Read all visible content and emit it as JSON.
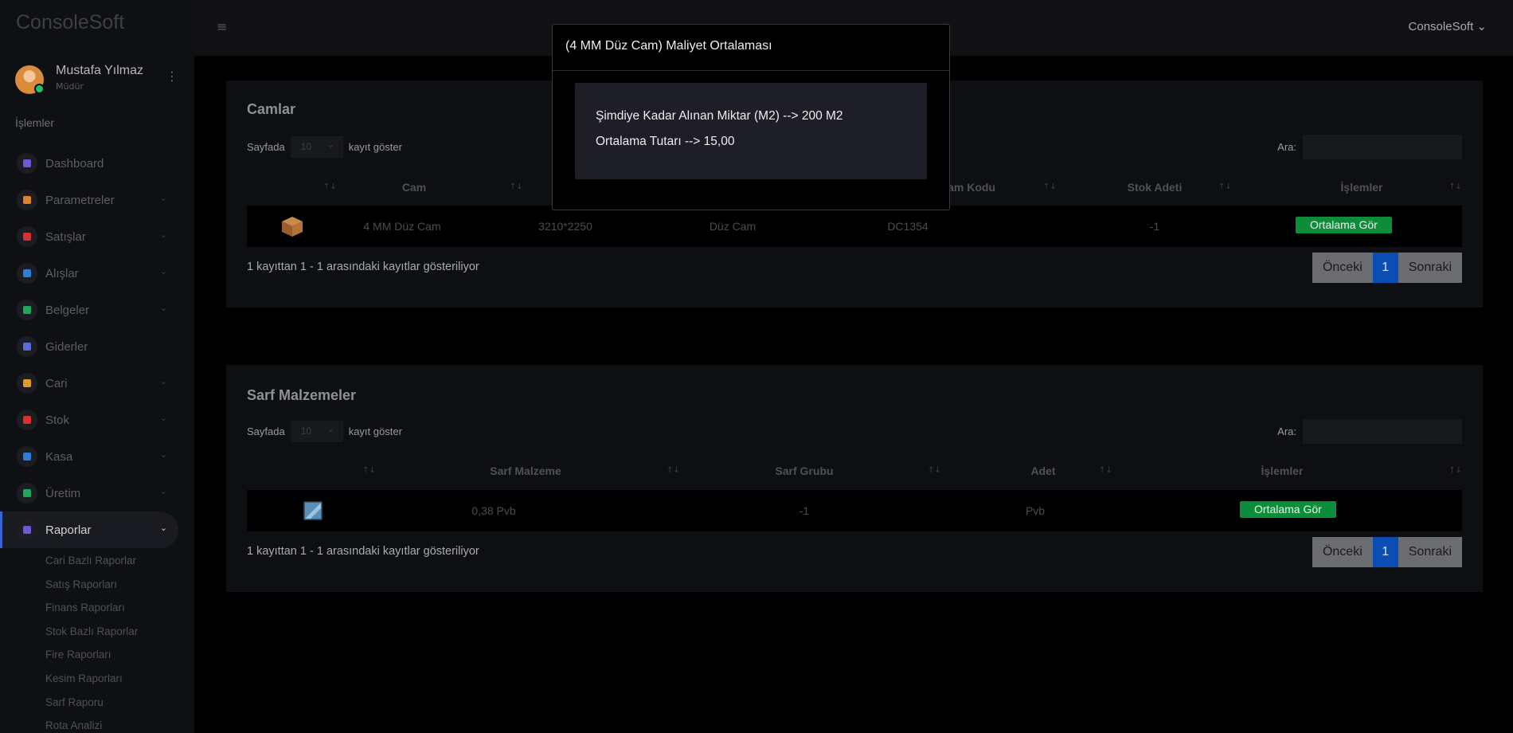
{
  "app": {
    "brand": "ConsoleSoft",
    "top_user": "ConsoleSoft"
  },
  "user": {
    "name": "Mustafa Yılmaz",
    "role": "Müdür"
  },
  "sidebar": {
    "section": "İşlemler",
    "items": [
      {
        "label": "Dashboard",
        "icon": "dashboard-icon",
        "color": "#6f58d6",
        "has_children": false
      },
      {
        "label": "Parametreler",
        "icon": "layers-icon",
        "color": "#e0822b",
        "has_children": true
      },
      {
        "label": "Satışlar",
        "icon": "sales-icon",
        "color": "#d93030",
        "has_children": true
      },
      {
        "label": "Alışlar",
        "icon": "purchase-icon",
        "color": "#2b7fd9",
        "has_children": true
      },
      {
        "label": "Belgeler",
        "icon": "documents-icon",
        "color": "#1fa85a",
        "has_children": true
      },
      {
        "label": "Giderler",
        "icon": "expense-icon",
        "color": "#5a6bd8",
        "has_children": false
      },
      {
        "label": "Cari",
        "icon": "users-icon",
        "color": "#e09b2b",
        "has_children": true
      },
      {
        "label": "Stok",
        "icon": "stock-icon",
        "color": "#d93030",
        "has_children": true
      },
      {
        "label": "Kasa",
        "icon": "cash-icon",
        "color": "#2b7fd9",
        "has_children": true
      },
      {
        "label": "Üretim",
        "icon": "production-icon",
        "color": "#1fa85a",
        "has_children": true
      },
      {
        "label": "Raporlar",
        "icon": "reports-icon",
        "color": "#6f58d6",
        "has_children": true,
        "active": true
      }
    ],
    "sub_items": [
      "Cari Bazlı Raporlar",
      "Satış Raporları",
      "Finans Raporları",
      "Stok Bazlı Raporlar",
      "Fire Raporları",
      "Kesim Raporları",
      "Sarf Raporu",
      "Rota Analizi"
    ]
  },
  "camlar": {
    "title": "Camlar",
    "length_prefix": "Sayfada",
    "length_value": "10",
    "length_suffix": "kayıt göster",
    "search_label": "Ara:",
    "headers": [
      "Cam",
      "",
      "",
      "Cam Kodu",
      "Stok Adeti",
      "İşlemler"
    ],
    "row": {
      "name": "4 MM Düz Cam",
      "size": "3210*2250",
      "group": "Düz Cam",
      "code": "DC1354",
      "stock": "-1",
      "action": "Ortalama Gör"
    },
    "info": "1 kayıttan 1 - 1 arasındaki kayıtlar gösteriliyor",
    "pager": {
      "prev": "Önceki",
      "current": "1",
      "next": "Sonraki"
    }
  },
  "sarf": {
    "title": "Sarf Malzemeler",
    "length_prefix": "Sayfada",
    "length_value": "10",
    "length_suffix": "kayıt göster",
    "search_label": "Ara:",
    "headers": [
      "Sarf Malzeme",
      "Sarf Grubu",
      "Adet",
      "İşlemler"
    ],
    "row": {
      "name": "0,38 Pvb",
      "group": "-1",
      "count": "Pvb",
      "action": "Ortalama Gör"
    },
    "info": "1 kayıttan 1 - 1 arasındaki kayıtlar gösteriliyor",
    "pager": {
      "prev": "Önceki",
      "current": "1",
      "next": "Sonraki"
    }
  },
  "modal": {
    "title": "(4 MM Düz Cam) Maliyet Ortalaması",
    "line1": "Şimdiye Kadar Alınan Miktar (M2) --> 200 M2",
    "line2": "Ortalama Tutarı --> 15,00"
  }
}
